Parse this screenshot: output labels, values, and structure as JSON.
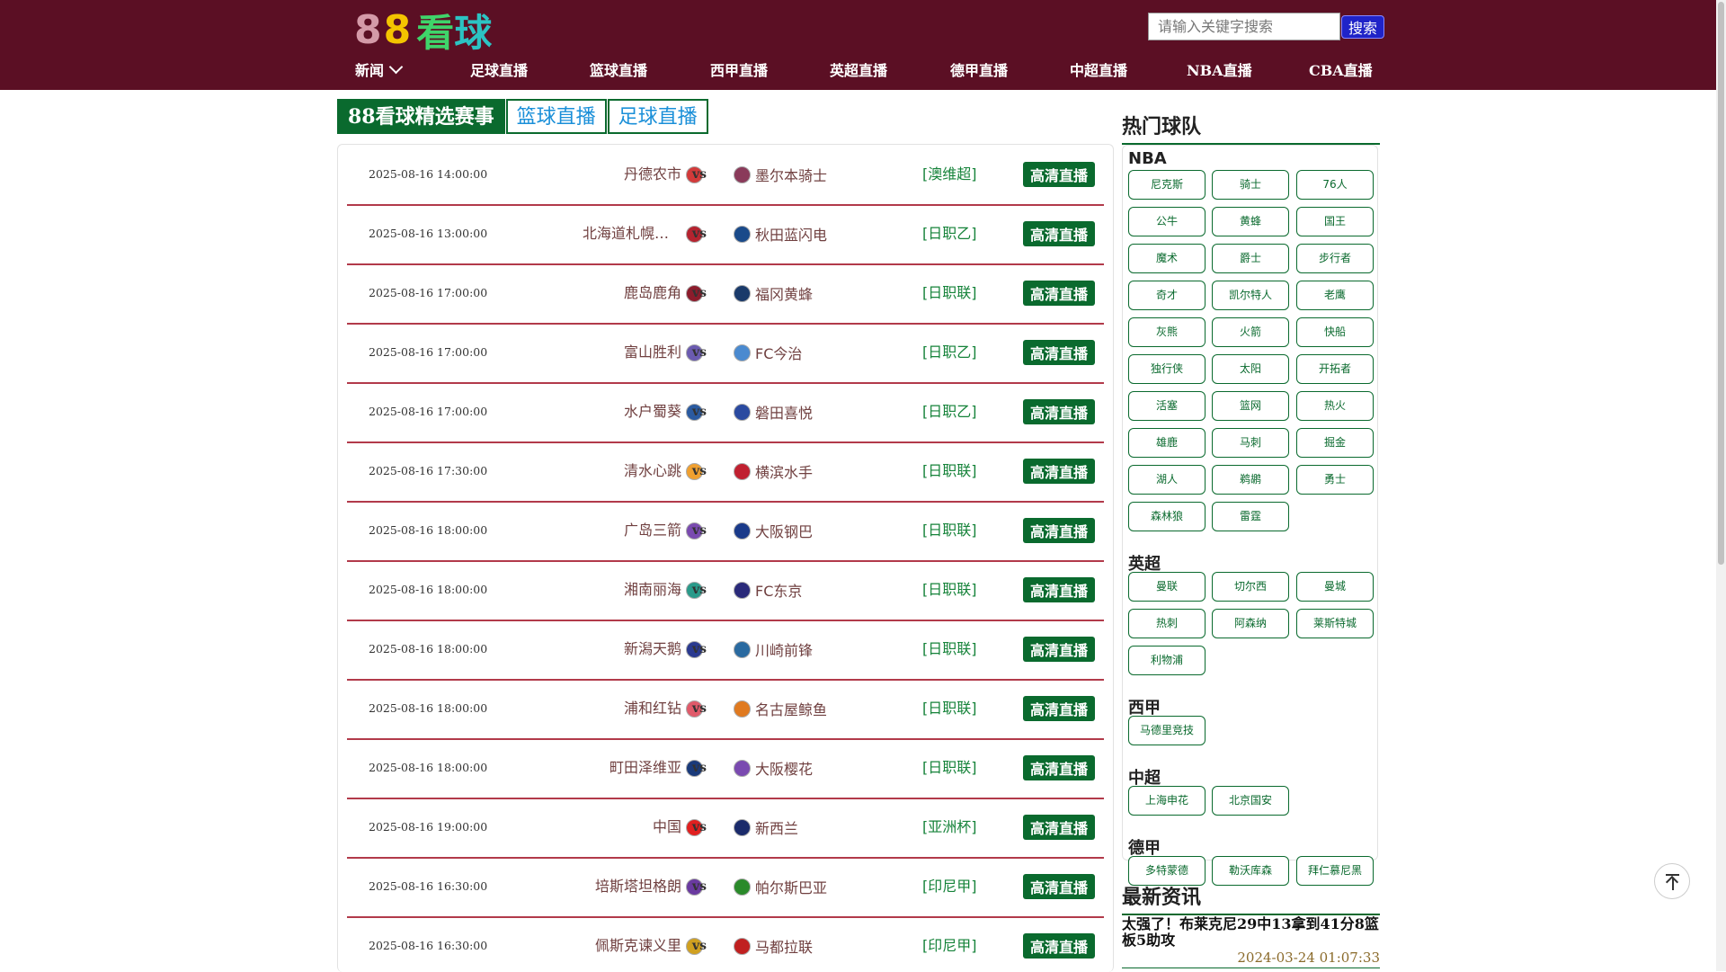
{
  "header": {
    "logo": {
      "d1": "8",
      "d2": "8",
      "k": "看",
      "q": "球"
    },
    "search": {
      "placeholder": "请输入关键字搜索",
      "button": "搜索"
    },
    "nav": [
      {
        "label": "新闻"
      },
      {
        "label": "足球直播"
      },
      {
        "label": "篮球直播"
      },
      {
        "label": "西甲直播"
      },
      {
        "label": "英超直播"
      },
      {
        "label": "德甲直播"
      },
      {
        "label": "中超直播"
      },
      {
        "label": "NBA直播"
      },
      {
        "label": "CBA直播"
      }
    ]
  },
  "tabs": [
    {
      "label": "88看球精选赛事"
    },
    {
      "label": "篮球直播"
    },
    {
      "label": "足球直播"
    }
  ],
  "matches": [
    {
      "time": "2025-08-16 14:00:00",
      "home": "丹德农市",
      "vs": "vs",
      "away": "墨尔本骑士",
      "league": "[澳维超]",
      "button": "高清直播"
    },
    {
      "time": "2025-08-16 13:00:00",
      "home": "北海道札幌冈萨多",
      "vs": "vs",
      "away": "秋田蓝闪电",
      "league": "[日职乙]",
      "button": "高清直播"
    },
    {
      "time": "2025-08-16 17:00:00",
      "home": "鹿岛鹿角",
      "vs": "vs",
      "away": "福冈黄蜂",
      "league": "[日职联]",
      "button": "高清直播"
    },
    {
      "time": "2025-08-16 17:00:00",
      "home": "富山胜利",
      "vs": "vs",
      "away": "FC今治",
      "league": "[日职乙]",
      "button": "高清直播"
    },
    {
      "time": "2025-08-16 17:00:00",
      "home": "水户蜀葵",
      "vs": "vs",
      "away": "磐田喜悦",
      "league": "[日职乙]",
      "button": "高清直播"
    },
    {
      "time": "2025-08-16 17:30:00",
      "home": "清水心跳",
      "vs": "vs",
      "away": "横滨水手",
      "league": "[日职联]",
      "button": "高清直播"
    },
    {
      "time": "2025-08-16 18:00:00",
      "home": "广岛三箭",
      "vs": "vs",
      "away": "大阪钢巴",
      "league": "[日职联]",
      "button": "高清直播"
    },
    {
      "time": "2025-08-16 18:00:00",
      "home": "湘南丽海",
      "vs": "vs",
      "away": "FC东京",
      "league": "[日职联]",
      "button": "高清直播"
    },
    {
      "time": "2025-08-16 18:00:00",
      "home": "新潟天鹅",
      "vs": "vs",
      "away": "川崎前锋",
      "league": "[日职联]",
      "button": "高清直播"
    },
    {
      "time": "2025-08-16 18:00:00",
      "home": "浦和红钻",
      "vs": "vs",
      "away": "名古屋鲸鱼",
      "league": "[日职联]",
      "button": "高清直播"
    },
    {
      "time": "2025-08-16 18:00:00",
      "home": "町田泽维亚",
      "vs": "vs",
      "away": "大阪樱花",
      "league": "[日职联]",
      "button": "高清直播"
    },
    {
      "time": "2025-08-16 19:00:00",
      "home": "中国",
      "vs": "vs",
      "away": "新西兰",
      "league": "[亚洲杯]",
      "button": "高清直播"
    },
    {
      "time": "2025-08-16 16:30:00",
      "home": "培斯塔坦格朗",
      "vs": "vs",
      "away": "帕尔斯巴亚",
      "league": "[印尼甲]",
      "button": "高清直播"
    },
    {
      "time": "2025-08-16 16:30:00",
      "home": "佩斯克谏义里",
      "vs": "vs",
      "away": "马都拉联",
      "league": "[印尼甲]",
      "button": "高清直播"
    }
  ],
  "crest_colors": {
    "home": [
      "#d23a3a",
      "#b5232f",
      "#8c1c2c",
      "#6b5bb0",
      "#2a5aa0",
      "#f0a030",
      "#7a4ab0",
      "#2a9a8a",
      "#2a3a90",
      "#e05a6a",
      "#1a3a7a",
      "#e02020",
      "#6a3aa0",
      "#d0a020"
    ],
    "away": [
      "#8a3a5a",
      "#1a4a8a",
      "#1a3a6a",
      "#4a8ad0",
      "#2a4aa0",
      "#c02030",
      "#1a3a8a",
      "#2a2a7a",
      "#2a6aa0",
      "#e07a20",
      "#7a4ab0",
      "#1a2a6a",
      "#2a8a2a",
      "#c02020"
    ]
  },
  "sidebar": {
    "hot_teams_title": "热门球队",
    "groups": [
      {
        "title": "NBA",
        "teams": [
          "尼克斯",
          "骑士",
          "76人",
          "公牛",
          "黄蜂",
          "国王",
          "魔术",
          "爵士",
          "步行者",
          "奇才",
          "凯尔特人",
          "老鹰",
          "灰熊",
          "火箭",
          "快船",
          "独行侠",
          "太阳",
          "开拓者",
          "活塞",
          "篮网",
          "热火",
          "雄鹿",
          "马刺",
          "掘金",
          "湖人",
          "鹈鹕",
          "勇士",
          "森林狼",
          "雷霆"
        ]
      },
      {
        "title": "英超",
        "teams": [
          "曼联",
          "切尔西",
          "曼城",
          "热刺",
          "阿森纳",
          "莱斯特城",
          "利物浦"
        ]
      },
      {
        "title": "西甲",
        "teams": [
          "马德里竞技"
        ]
      },
      {
        "title": "中超",
        "teams": [
          "上海申花",
          "北京国安"
        ]
      },
      {
        "title": "德甲",
        "teams": [
          "多特蒙德",
          "勒沃库森",
          "拜仁慕尼黑"
        ]
      }
    ],
    "news_title": "最新资讯",
    "news": [
      {
        "headline": "太强了！布莱克尼29中13拿到41分8篮板5助攻",
        "date": "2024-03-24 01:07:33"
      }
    ]
  },
  "colors": {
    "header_bg": "#5b0f24",
    "accent_green": "#0a6a2e",
    "row_divider": "#b23a4a",
    "league_text": "#16833a"
  }
}
